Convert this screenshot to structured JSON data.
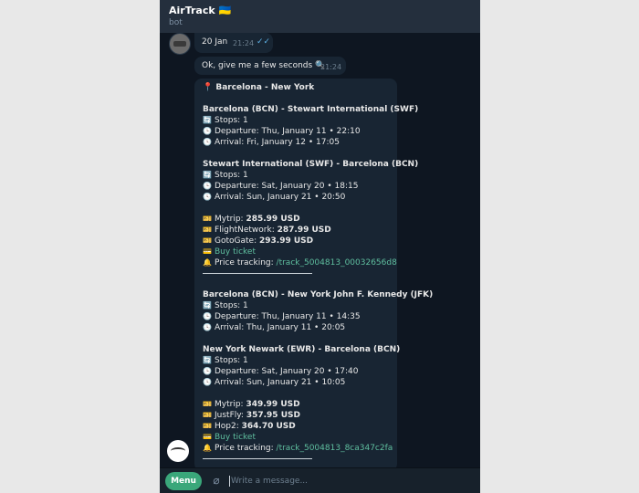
{
  "header": {
    "title": "AirTrack 🇺🇦",
    "subtitle": "bot"
  },
  "messages": {
    "m1": {
      "text": "20 Jan",
      "time": "21:24",
      "ticks": "✓✓"
    },
    "m2": {
      "text": "Ok, give me a few seconds 🔍",
      "time": "21:24"
    },
    "result": {
      "route_title": "📍 Barcelona - New York",
      "option1": {
        "outbound_title": "Barcelona (BCN) - Stewart International (SWF)",
        "outbound_stops": "Stops: 1",
        "outbound_departure": "Departure: Thu, January 11 • 22:10",
        "outbound_arrival": "Arrival: Fri, January 12 • 17:05",
        "return_title": "Stewart International (SWF) - Barcelona (BCN)",
        "return_stops": "Stops: 1",
        "return_departure": "Departure: Sat, January 20 • 18:15",
        "return_arrival": "Arrival: Sun, January 21 • 20:50",
        "prices": [
          {
            "vendor": "Mytrip:",
            "price": "285.99 USD"
          },
          {
            "vendor": "FlightNetwork:",
            "price": "287.99 USD"
          },
          {
            "vendor": "GotoGate:",
            "price": "293.99 USD"
          }
        ],
        "buy_label": "Buy ticket",
        "tracking_label": "Price tracking:",
        "tracking_link": "/track_5004813_00032656d8"
      },
      "option2": {
        "outbound_title": "Barcelona (BCN) - New York John F. Kennedy (JFK)",
        "outbound_stops": "Stops: 1",
        "outbound_departure": "Departure: Thu, January 11 • 14:35",
        "outbound_arrival": "Arrival: Thu, January 11 • 20:05",
        "return_title": "New York Newark (EWR) - Barcelona (BCN)",
        "return_stops": "Stops: 1",
        "return_departure": "Departure: Sat, January 20 • 17:40",
        "return_arrival": "Arrival: Sun, January 21 • 10:05",
        "prices": [
          {
            "vendor": "Mytrip:",
            "price": "349.99 USD"
          },
          {
            "vendor": "JustFly:",
            "price": "357.95 USD"
          },
          {
            "vendor": "Hop2:",
            "price": "364.70 USD"
          }
        ],
        "buy_label": "Buy ticket",
        "tracking_label": "Price tracking:",
        "tracking_link": "/track_5004813_8ca347c2fa"
      }
    }
  },
  "icons": {
    "stops": "🔄",
    "departure": "🕒",
    "arrival": "🕓",
    "price": "🎫",
    "buy": "💳",
    "tracking": "🔔"
  },
  "composer": {
    "menu_label": "Menu",
    "placeholder": "Write a message..."
  },
  "colors": {
    "accent": "#3aa77a",
    "link": "#5fbf9f",
    "background": "#0e1621",
    "bubble": "#182533"
  }
}
